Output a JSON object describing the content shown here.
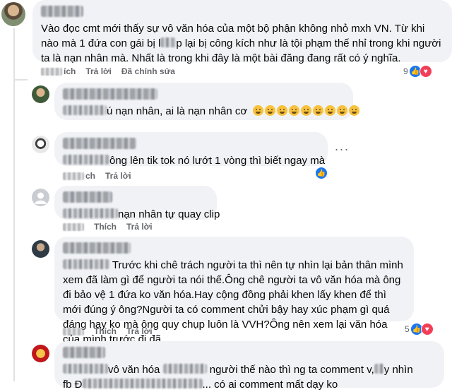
{
  "actions": {
    "like": "Thích",
    "reply": "Trả lời",
    "edited": "Đã chỉnh sửa"
  },
  "comments": [
    {
      "text": "Vào đọc cmt mới thấy sự vô văn hóa của một bộ phận không nhỏ mxh VN. Từ khi nào mà 1 đứa con gái bị l",
      "text_b": "p lại bị công kích như là tội phạm thế nhỉ trong khi người ta là nạn nhân mà. Nhất là trong khi đây là một bài đăng đang rất có ý nghĩa.",
      "like_fragment": "ích",
      "reactions": "9"
    },
    {
      "text": "ú nạn nhân, ai là nạn nhân cơ"
    },
    {
      "text": "ông lên tik tok nó lướt 1 vòng thì biết ngay mà"
    },
    {
      "text": "nạn nhân tự quay clip"
    },
    {
      "text": "Trước khi chê trách người ta thì nên tự nhìn lại bản thân mình xem đã làm gì để người ta nói thế.Ông chê người ta vô văn hóa mà ông đi bảo vệ 1 đứa ko văn hóa.Hay cộng đồng phải khen lấy khen để thì mới đúng ý ông?Người ta có comment chửi bậy hay xúc phạm gì quá đáng hay ko mà ông quy chụp luôn là VVH?Ông nên xem lại văn hóa của mình trước đi đã",
      "reactions": "5"
    },
    {
      "text_a": "vô văn hóa",
      "text_b": "người thế nào thì ng ta comment v,",
      "text_c": "y nhìn",
      "text_d": "fb Đ",
      "text_e": "... có ai comment mất dạy ko"
    }
  ]
}
